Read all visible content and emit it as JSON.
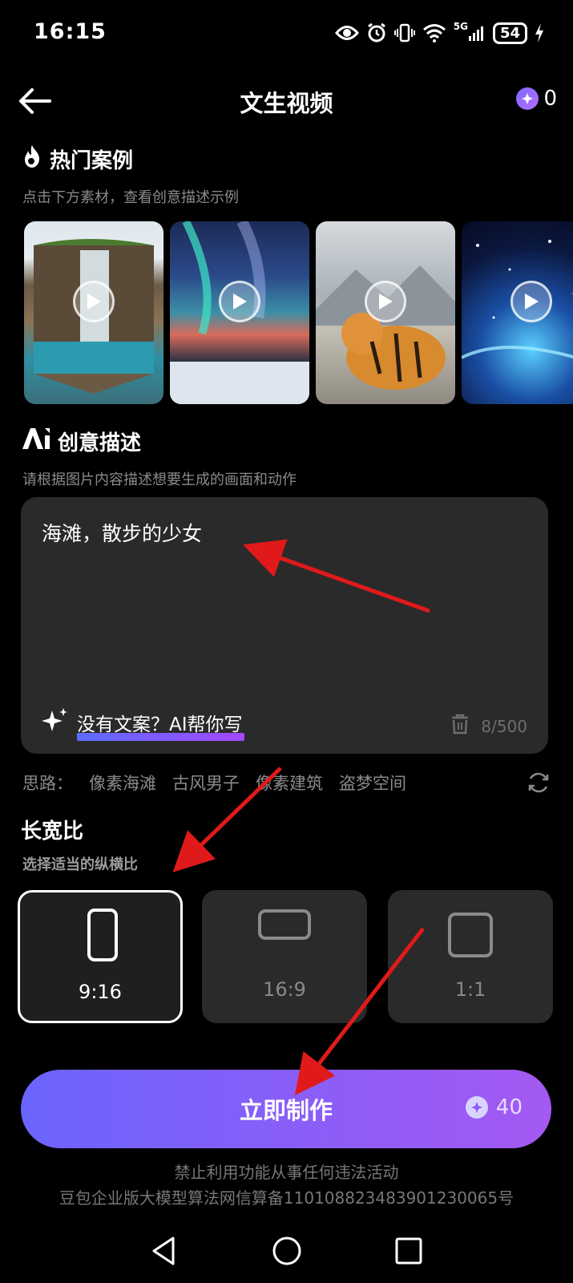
{
  "status_bar": {
    "time": "16:15",
    "network": "5G",
    "battery": "54"
  },
  "header": {
    "title": "文生视频",
    "credits": "0"
  },
  "hot_cases": {
    "title": "热门案例",
    "subtitle": "点击下方素材，查看创意描述示例",
    "items": [
      {
        "name": "waterfall-cube"
      },
      {
        "name": "aurora-lake"
      },
      {
        "name": "tiger"
      },
      {
        "name": "galaxy-sea"
      }
    ]
  },
  "creative": {
    "title": "创意描述",
    "subtitle": "请根据图片内容描述想要生成的画面和动作",
    "prompt_value": "海滩，散步的少女",
    "ai_write_label": "没有文案？AI帮你写",
    "counter": "8/500"
  },
  "ideas": {
    "label": "思路：",
    "items": [
      "像素海滩",
      "古风男子",
      "像素建筑",
      "盗梦空间"
    ]
  },
  "aspect": {
    "title": "长宽比",
    "subtitle": "选择适当的纵横比",
    "options": [
      {
        "label": "9:16",
        "selected": true
      },
      {
        "label": "16:9",
        "selected": false
      },
      {
        "label": "1:1",
        "selected": false
      }
    ]
  },
  "cta": {
    "label": "立即制作",
    "cost": "40"
  },
  "footer": {
    "line1": "禁止利用功能从事任何违法活动",
    "line2": "豆包企业版大模型算法网信算备110108823483901230065号"
  },
  "colors": {
    "accent_start": "#6b64ff",
    "accent_end": "#a459f2",
    "annotation_arrow": "#e01a1a"
  }
}
